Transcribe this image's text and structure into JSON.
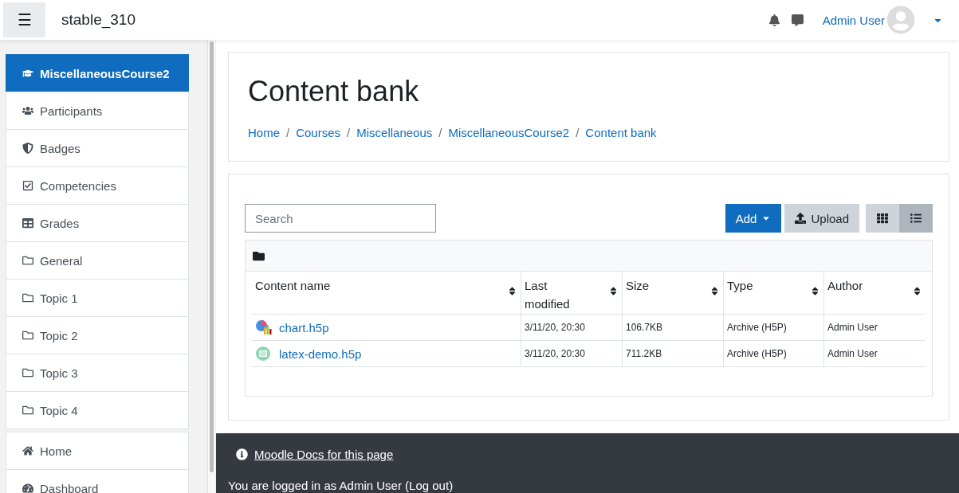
{
  "navbar": {
    "menu_button": "☰",
    "site_name": "stable_310",
    "user_name": "Admin User"
  },
  "sidebar": {
    "groups": [
      [
        {
          "label": "MiscellaneousCourse2",
          "kind": "course",
          "selected": true
        },
        {
          "label": "Participants",
          "kind": "users",
          "selected": false
        },
        {
          "label": "Badges",
          "kind": "badge",
          "selected": false
        },
        {
          "label": "Competencies",
          "kind": "check",
          "selected": false
        },
        {
          "label": "Grades",
          "kind": "grid",
          "selected": false
        },
        {
          "label": "General",
          "kind": "folder",
          "selected": false
        },
        {
          "label": "Topic 1",
          "kind": "folder",
          "selected": false
        },
        {
          "label": "Topic 2",
          "kind": "folder",
          "selected": false
        },
        {
          "label": "Topic 3",
          "kind": "folder",
          "selected": false
        },
        {
          "label": "Topic 4",
          "kind": "folder",
          "selected": false
        }
      ],
      [
        {
          "label": "Home",
          "kind": "home",
          "selected": false
        },
        {
          "label": "Dashboard",
          "kind": "dashboard",
          "selected": false
        }
      ]
    ]
  },
  "header": {
    "title": "Content bank",
    "breadcrumb_separator": "/",
    "breadcrumb": [
      "Home",
      "Courses",
      "Miscellaneous",
      "MiscellaneousCourse2",
      "Content bank"
    ]
  },
  "toolbar": {
    "search": {
      "placeholder": "Search"
    },
    "add_button": "Add",
    "upload_button": "Upload",
    "views": [
      {
        "kind": "grid",
        "selected": false
      },
      {
        "kind": "list",
        "selected": true
      }
    ]
  },
  "table": {
    "columns": [
      "Content name",
      "Last modified",
      "Size",
      "Type",
      "Author"
    ],
    "rows": [
      {
        "kind": "chart",
        "name": "chart.h5p",
        "modified": "3/11/20, 20:30",
        "size": "106.7KB",
        "type": "Archive (H5P)",
        "author": "Admin User"
      },
      {
        "kind": "doc",
        "name": "latex-demo.h5p",
        "modified": "3/11/20, 20:30",
        "size": "711.2KB",
        "type": "Archive (H5P)",
        "author": "Admin User"
      }
    ]
  },
  "footer": {
    "docs_link": "Moodle Docs for this page",
    "login_text": "You are logged in as Admin User (Log out)"
  }
}
